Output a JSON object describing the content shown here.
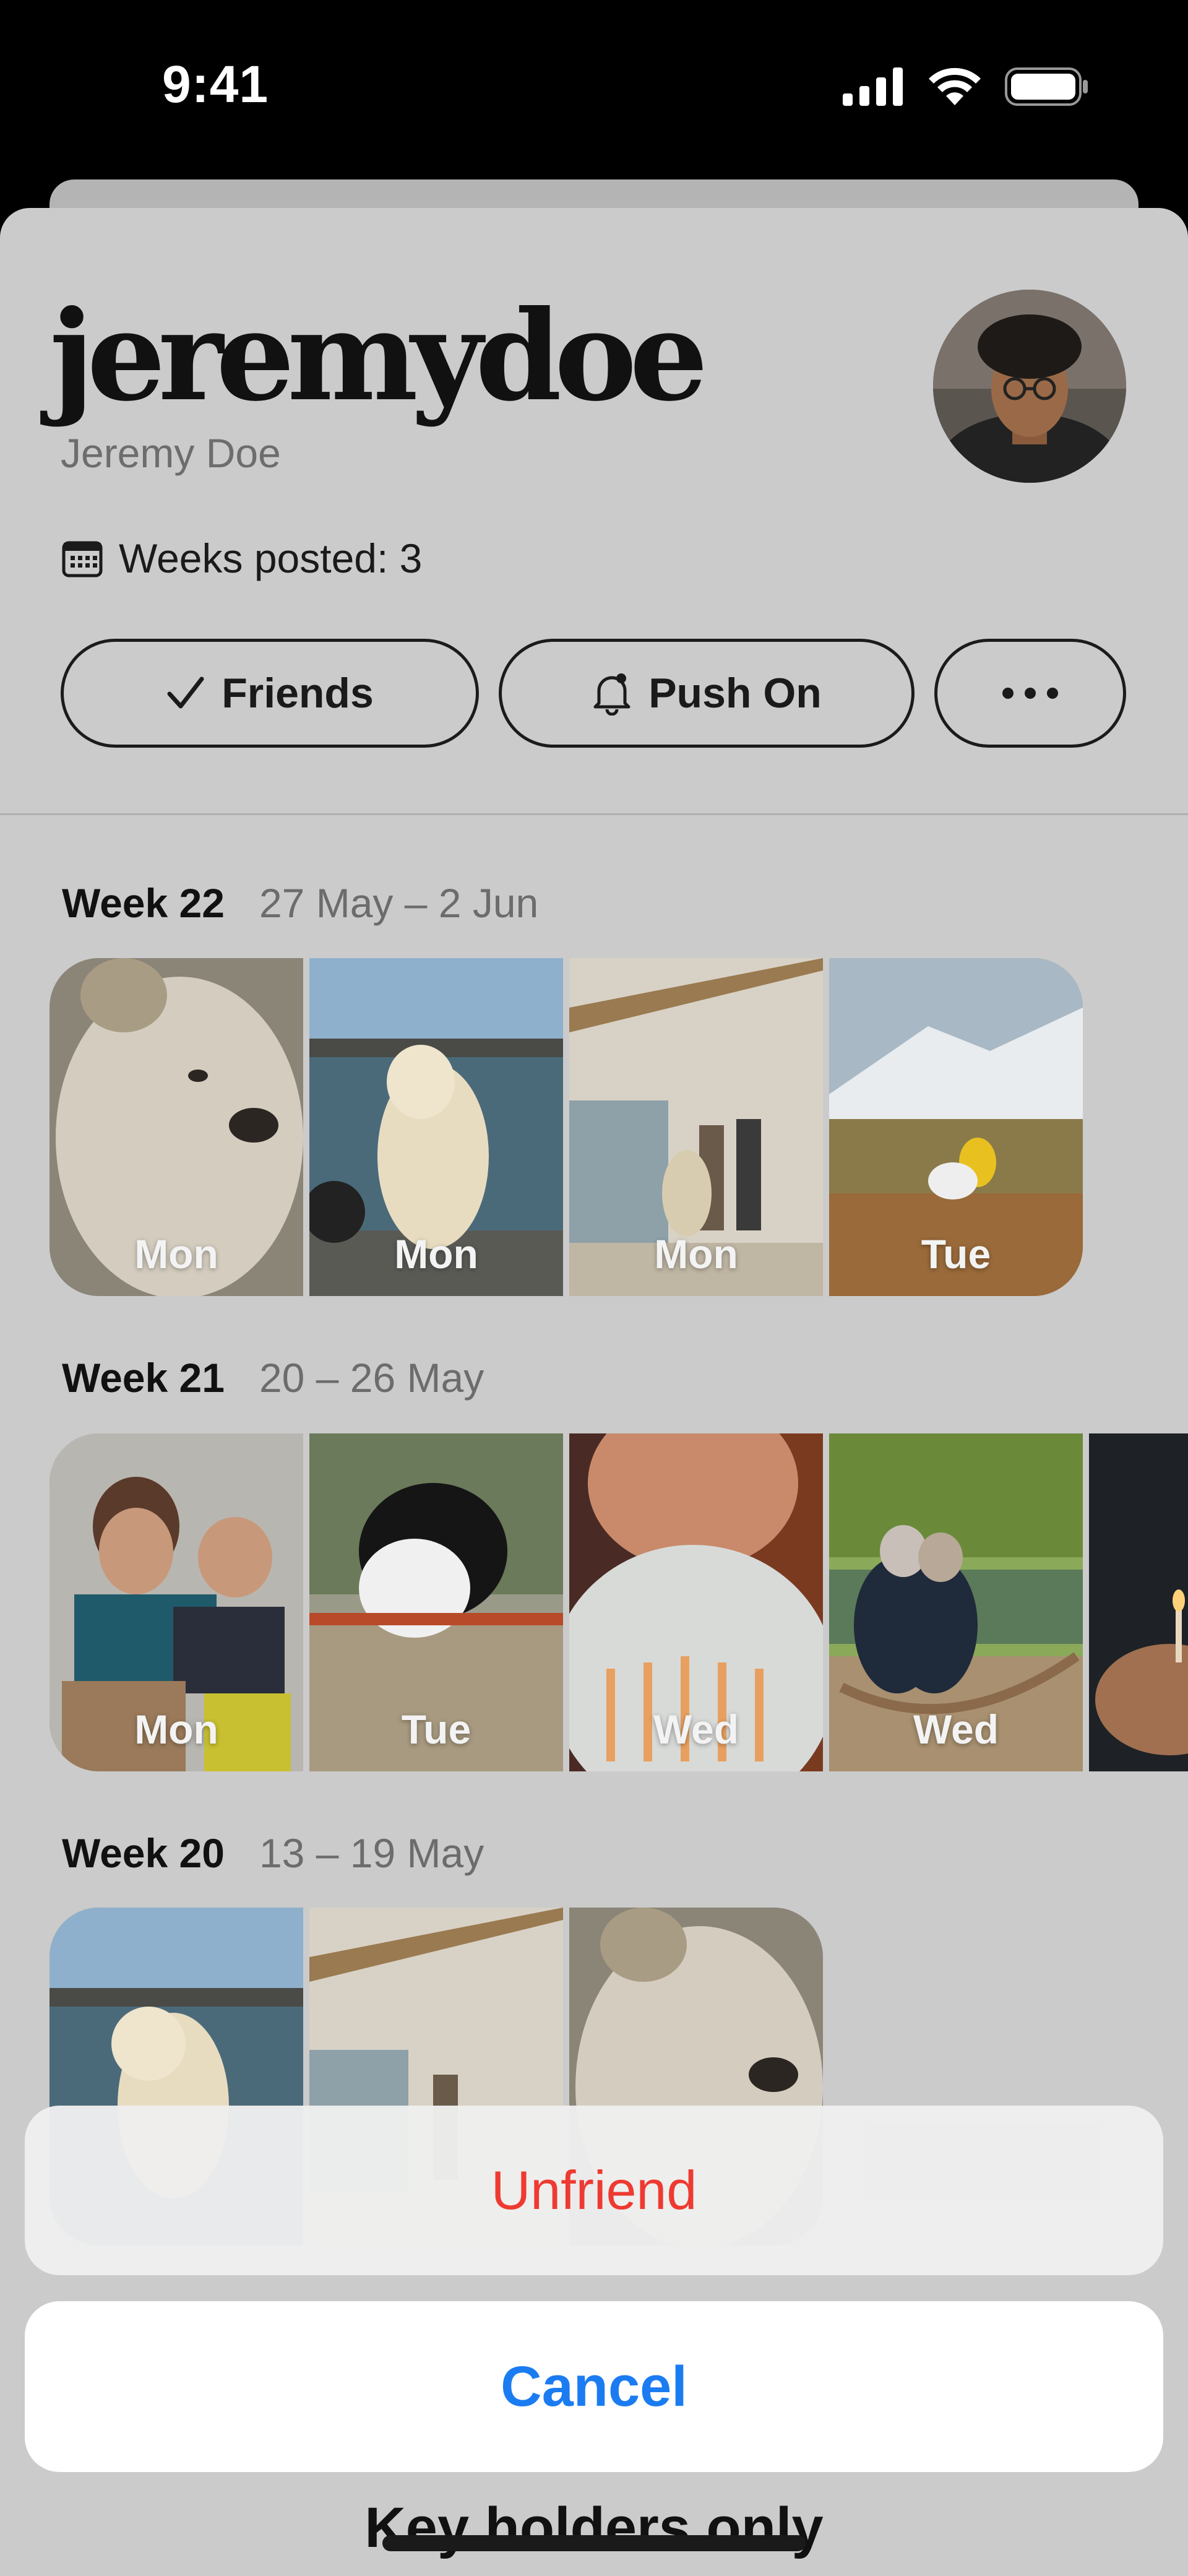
{
  "status_bar": {
    "time": "9:41",
    "icons": [
      "signal-icon",
      "wifi-icon",
      "battery-icon"
    ]
  },
  "profile": {
    "handle": "jeremydoe",
    "full_name": "Jeremy Doe",
    "weeks_posted": "Weeks posted: 3",
    "avatar": "avatar-photo"
  },
  "buttons": {
    "friends": "Friends",
    "push": "Push On",
    "more": "..."
  },
  "weeks": [
    {
      "week": "Week 22",
      "range": "27 May – 2 Jun",
      "days": [
        "Mon",
        "Mon",
        "Mon",
        "Tue"
      ]
    },
    {
      "week": "Week 21",
      "range": "20 – 26 May",
      "days": [
        "Mon",
        "Tue",
        "Wed",
        "Wed",
        "W"
      ]
    },
    {
      "week": "Week 20",
      "range": "13 – 19 May",
      "days": [
        "",
        "",
        ""
      ]
    }
  ],
  "action_sheet": {
    "unfriend": "Unfriend",
    "cancel": "Cancel"
  },
  "footer": {
    "label": "Key holders only"
  },
  "colors": {
    "destructive": "#ee3a31",
    "accent": "#1b7cf2",
    "sheet_bg": "#cbcbcb"
  }
}
